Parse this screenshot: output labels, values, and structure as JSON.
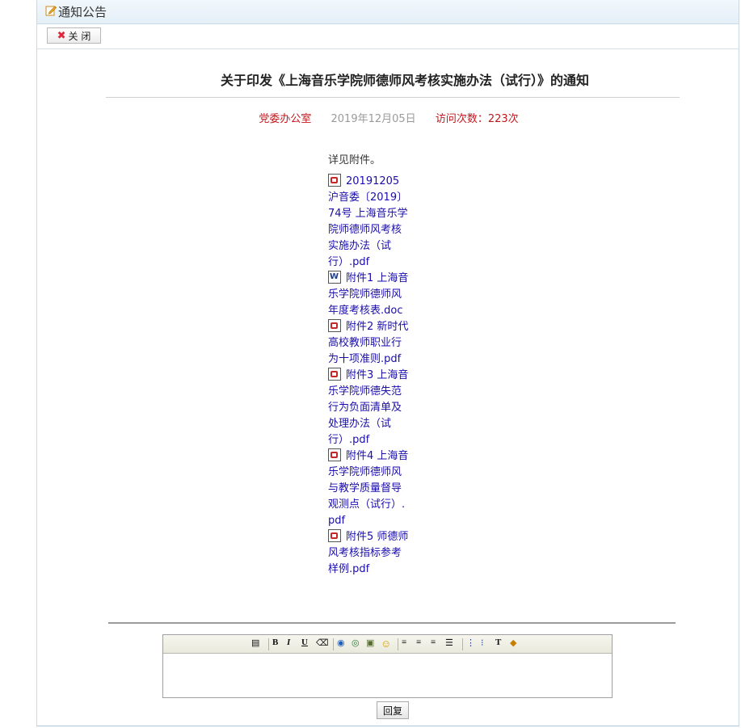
{
  "panel": {
    "title": "通知公告",
    "icon": "edit-note-icon"
  },
  "toolbar": {
    "close_label": "关 闭",
    "close_icon": "close-x-icon"
  },
  "notice": {
    "title": "关于印发《上海音乐学院师德师风考核实施办法（试行）》的通知",
    "department": "党委办公室",
    "date": "2019年12月05日",
    "views": "访问次数：223次",
    "lead": "详见附件。",
    "attachments": [
      {
        "type": "pdf",
        "name": "20191205沪音委〔2019〕74号 上海音乐学院师德师风考核实施办法（试行）.pdf"
      },
      {
        "type": "doc",
        "name": "附件1 上海音乐学院师德师风年度考核表.doc"
      },
      {
        "type": "pdf",
        "name": "附件2 新时代高校教师职业行为十项准则.pdf"
      },
      {
        "type": "pdf",
        "name": "附件3 上海音乐学院师德失范行为负面清单及处理办法（试行）.pdf"
      },
      {
        "type": "pdf",
        "name": "附件4 上海音乐学院师德师风与教学质量督导观测点（试行）.pdf"
      },
      {
        "type": "pdf",
        "name": "附件5 师德师风考核指标参考样例.pdf"
      }
    ]
  },
  "editor": {
    "toolbar": [
      {
        "name": "source-icon",
        "glyph": "▤"
      },
      {
        "name": "bold-icon",
        "glyph": "B"
      },
      {
        "name": "italic-icon",
        "glyph": "I"
      },
      {
        "name": "underline-icon",
        "glyph": "U"
      },
      {
        "name": "eraser-icon",
        "glyph": "⌫"
      },
      {
        "name": "link-icon",
        "glyph": "◉"
      },
      {
        "name": "unlink-icon",
        "glyph": "◎"
      },
      {
        "name": "image-icon",
        "glyph": "▣"
      },
      {
        "name": "emoticon-icon",
        "glyph": "☺"
      },
      {
        "name": "align-left-icon",
        "glyph": "≡"
      },
      {
        "name": "align-center-icon",
        "glyph": "≡"
      },
      {
        "name": "align-right-icon",
        "glyph": "≡"
      },
      {
        "name": "justify-icon",
        "glyph": "☰"
      },
      {
        "name": "ordered-list-icon",
        "glyph": "⋮"
      },
      {
        "name": "unordered-list-icon",
        "glyph": "⁝"
      },
      {
        "name": "text-color-icon",
        "glyph": "T"
      },
      {
        "name": "background-color-icon",
        "glyph": "◆"
      }
    ],
    "reply_label": "回复"
  }
}
